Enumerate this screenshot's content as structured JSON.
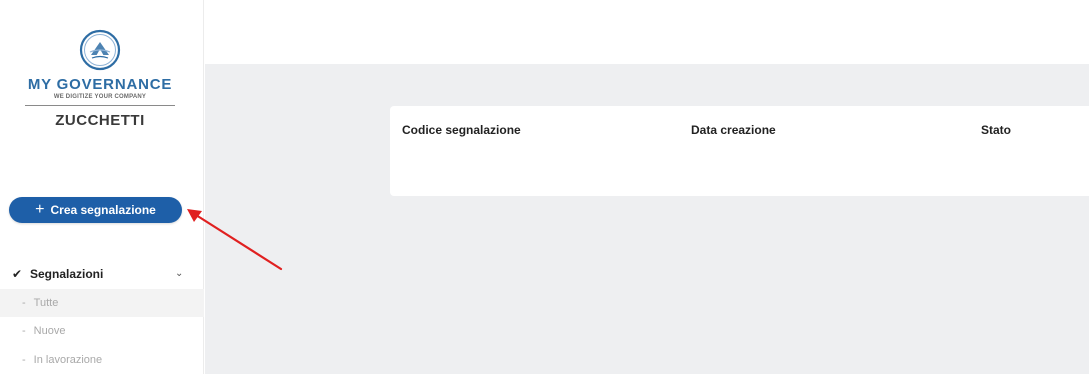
{
  "sidebar": {
    "logo": {
      "brand_name": "MY GOVERNANCE",
      "tagline": "WE DIGITIZE YOUR COMPANY",
      "company": "ZUCCHETTI",
      "icon": "my-governance-logo-icon"
    },
    "create_button": {
      "label": "Crea segnalazione",
      "icon": "plus-icon"
    },
    "nav": {
      "section": {
        "label": "Segnalazioni",
        "icon": "check-icon",
        "chevron": "chevron-down-icon"
      },
      "items": [
        {
          "label": "Tutte",
          "active": true
        },
        {
          "label": "Nuove",
          "active": false
        },
        {
          "label": "In lavorazione",
          "active": false
        }
      ]
    }
  },
  "table": {
    "columns": [
      "Codice segnalazione",
      "Data creazione",
      "Stato"
    ]
  },
  "colors": {
    "primary_button": "#1e5fa8",
    "brand_blue": "#2e6da4",
    "main_background": "#eeeff1",
    "annotation_arrow": "#e02020"
  },
  "annotation": {
    "type": "arrow",
    "target": "create_button"
  }
}
